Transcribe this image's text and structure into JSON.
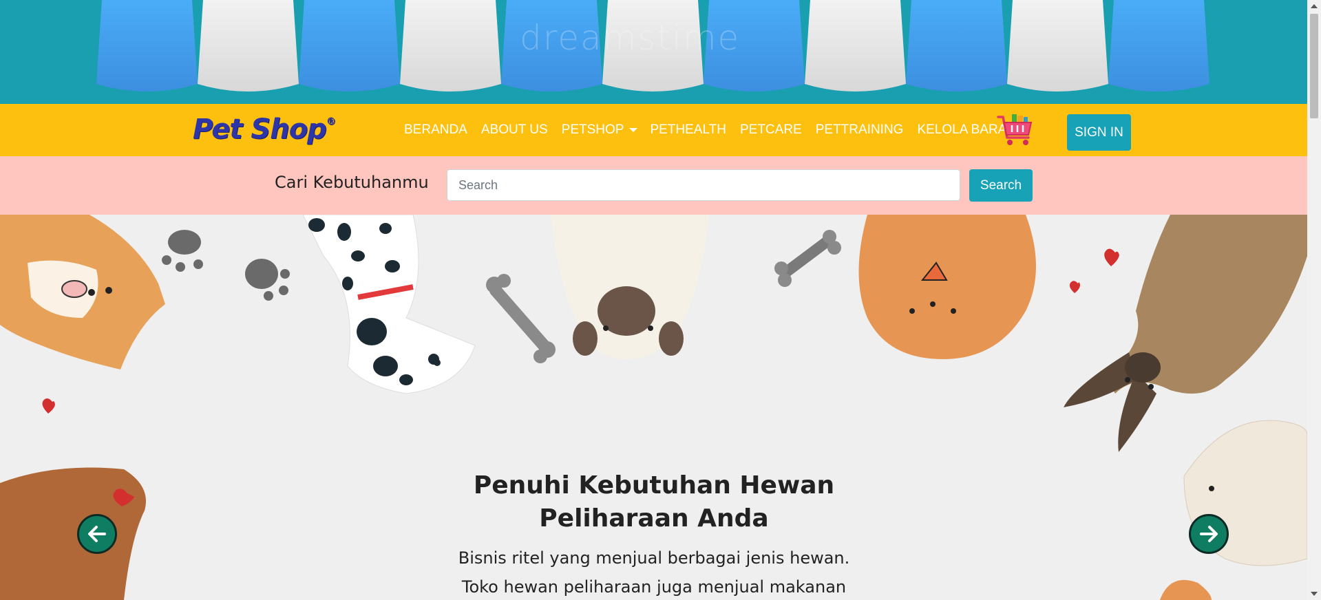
{
  "brand": {
    "name": "Pet Shop",
    "mark": "®"
  },
  "nav": {
    "items": [
      {
        "label": "BERANDA"
      },
      {
        "label": "ABOUT US"
      },
      {
        "label": "PETSHOP",
        "dropdown": true
      },
      {
        "label": "PETHEALTH"
      },
      {
        "label": "PETCARE"
      },
      {
        "label": "PETTRAINING"
      },
      {
        "label": "KELOLA BARANG"
      }
    ],
    "cart_icon": "shopping-cart-icon",
    "signin_label": "SIGN IN"
  },
  "search": {
    "label": "Cari Kebutuhanmu",
    "placeholder": "Search",
    "value": "",
    "button_label": "Search"
  },
  "hero": {
    "title_line1": "Penuhi Kebutuhan Hewan",
    "title_line2": "Peliharaan Anda",
    "text_line1": "Bisnis ritel yang menjual berbagai jenis hewan.",
    "text_line2": "Toko hewan peliharaan juga menjual makanan",
    "prev_icon": "arrow-left-icon",
    "next_icon": "arrow-right-icon"
  },
  "banner": {
    "watermark": "dreamstime"
  },
  "colors": {
    "awning_blue": "#45a8f5",
    "awning_white": "#ececec",
    "awning_bg": "#1a9fb0",
    "navbar": "#fec00f",
    "search_bar": "#ffc6bf",
    "accent": "#17a2b8",
    "brand": "#2d35a7",
    "carousel_button": "#0f7d62"
  }
}
